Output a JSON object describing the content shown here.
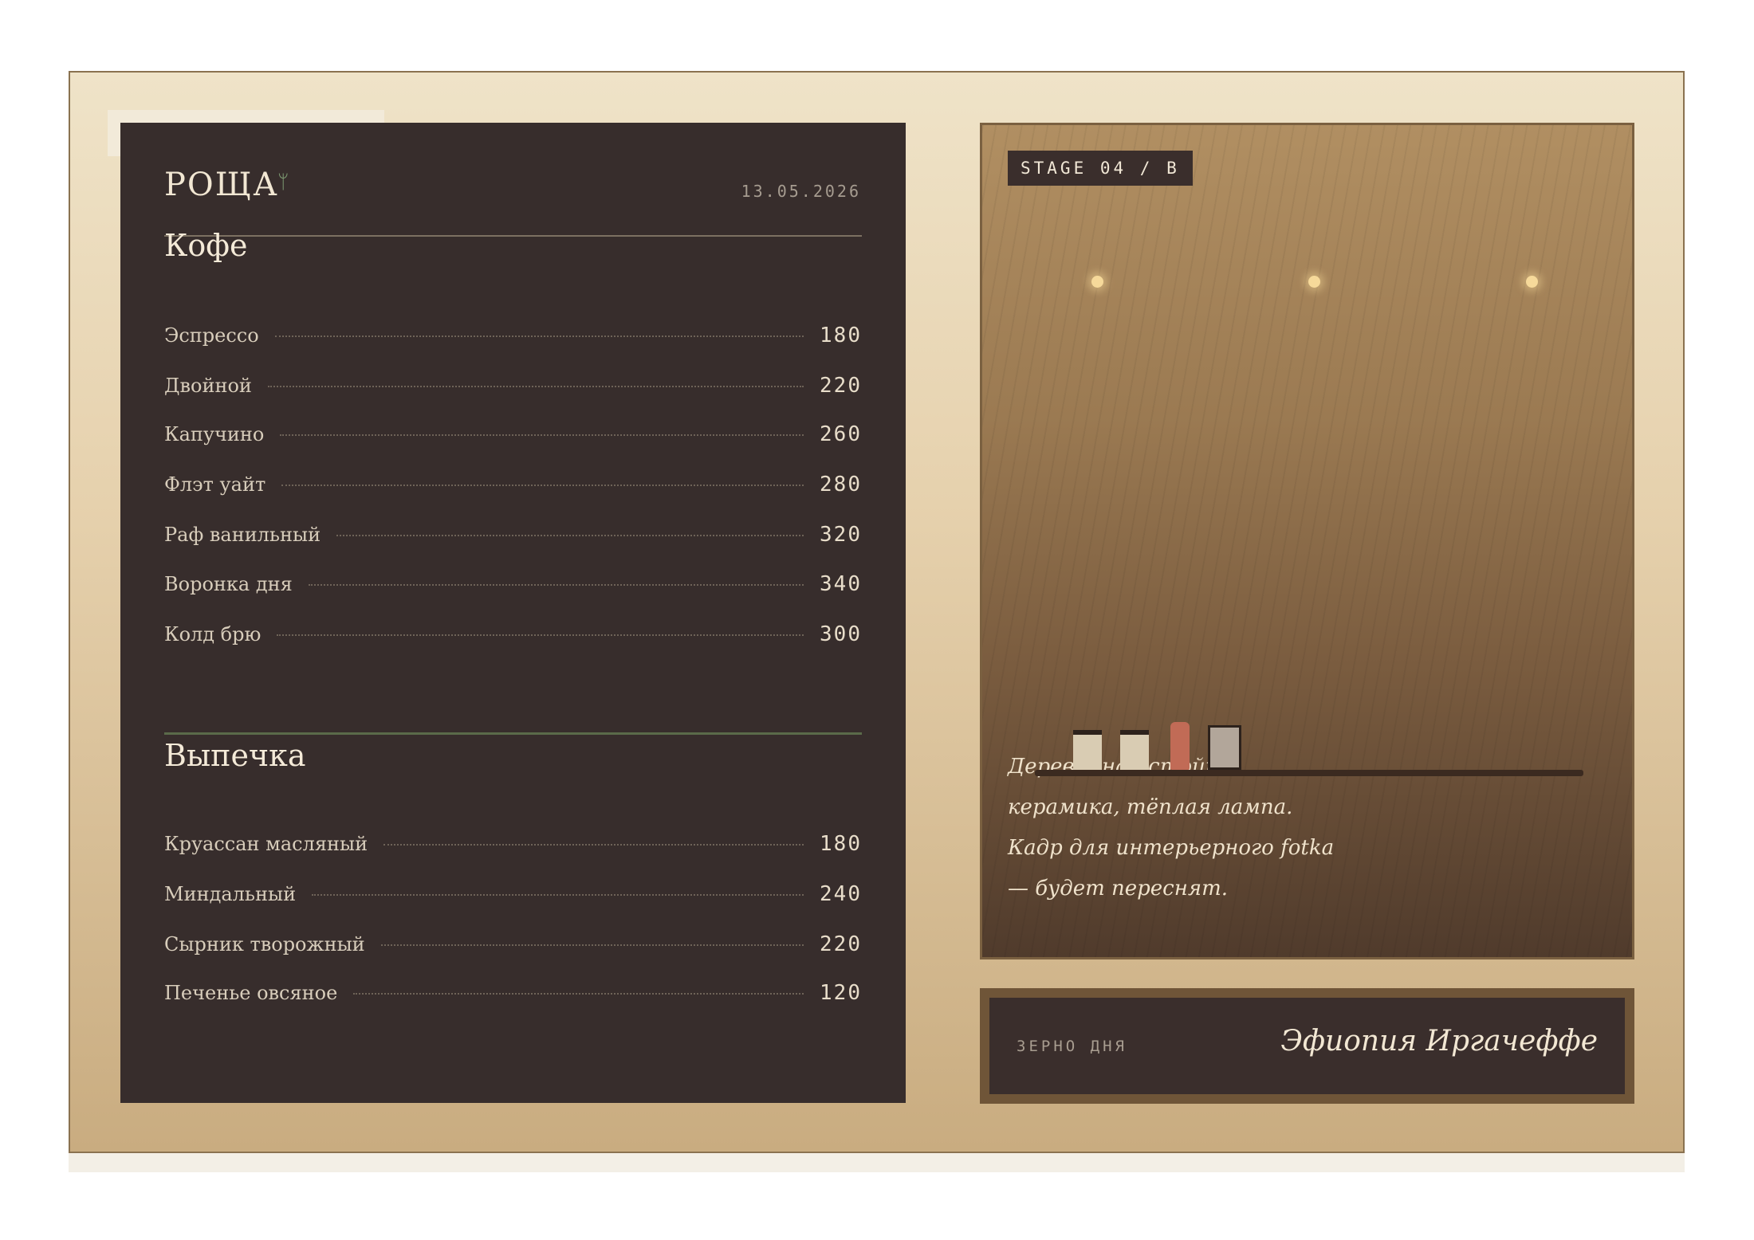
{
  "brand": {
    "name": "РОЩА",
    "mark": "ᛘ"
  },
  "date": "13.05.2026",
  "sections": [
    {
      "title": "Кофе",
      "items": [
        {
          "name": "Эспрессо",
          "price": "180"
        },
        {
          "name": "Двойной",
          "price": "220"
        },
        {
          "name": "Капучино",
          "price": "260"
        },
        {
          "name": "Флэт уайт",
          "price": "280"
        },
        {
          "name": "Раф ванильный",
          "price": "320"
        },
        {
          "name": "Воронка дня",
          "price": "340"
        },
        {
          "name": "Колд брю",
          "price": "300"
        }
      ]
    },
    {
      "title": "Выпечка",
      "items": [
        {
          "name": "Круассан масляный",
          "price": "180"
        },
        {
          "name": "Миндальный",
          "price": "240"
        },
        {
          "name": "Сырник творожный",
          "price": "220"
        },
        {
          "name": "Печенье овсяное",
          "price": "120"
        }
      ]
    }
  ],
  "photo": {
    "stage_label": "STAGE 04 / B",
    "caption_lines": [
      "Деревянная стойка,",
      "керамика, тёплая лампа.",
      "Кадр для интерьерного fotka",
      "— будет переснят."
    ]
  },
  "bean_of_day": {
    "label": "ЗЕРНО ДНЯ",
    "name": "Эфиопия Иргачеффе"
  },
  "colors": {
    "board": "#372d2c",
    "frame_gold": "#c9ac80",
    "accent_green": "#7d9a72",
    "lamp": "#f6d99a"
  }
}
